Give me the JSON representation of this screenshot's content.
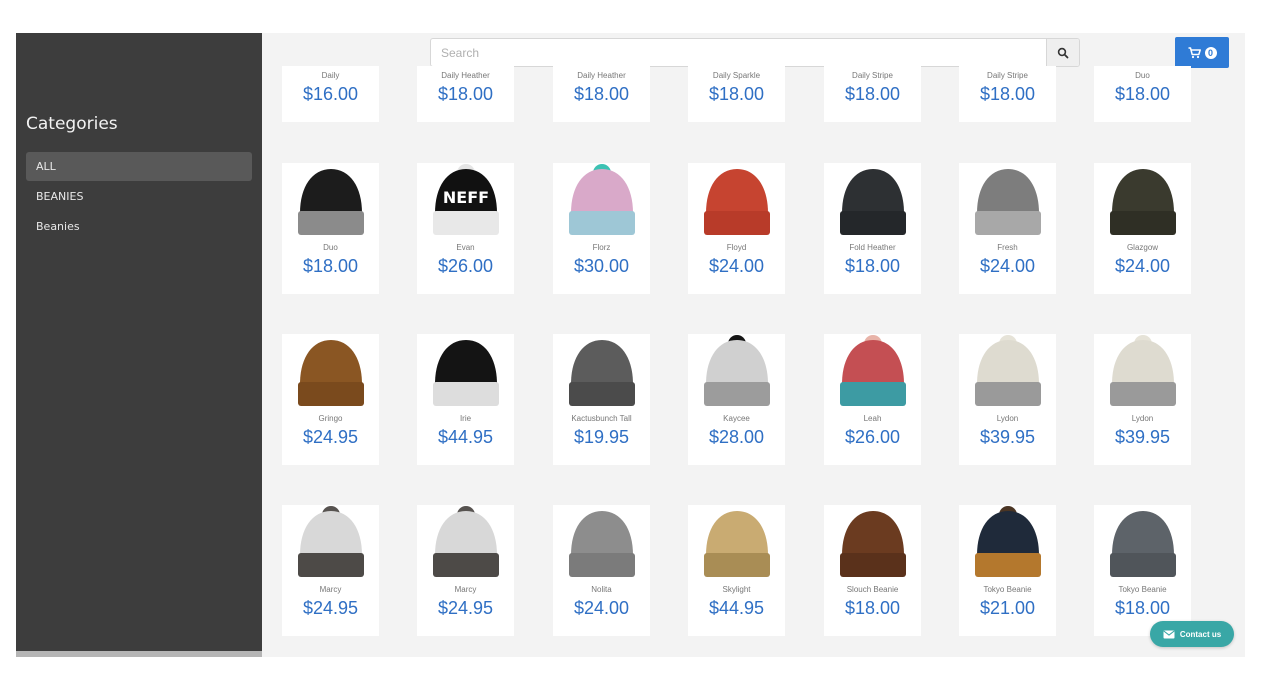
{
  "sidebar": {
    "title": "Categories",
    "items": [
      {
        "label": "ALL",
        "active": true
      },
      {
        "label": "BEANIES",
        "active": false
      },
      {
        "label": "Beanies",
        "active": false
      }
    ]
  },
  "header": {
    "search_placeholder": "Search",
    "search_icon": "search-icon",
    "cart_icon": "cart-icon",
    "cart_count": "0"
  },
  "contact": {
    "label": "Contact us",
    "icon": "mail-icon"
  },
  "products": [
    {
      "name": "Daily",
      "price": "$16.00"
    },
    {
      "name": "Daily Heather",
      "price": "$18.00"
    },
    {
      "name": "Daily Heather",
      "price": "$18.00"
    },
    {
      "name": "Daily Sparkle",
      "price": "$18.00"
    },
    {
      "name": "Daily Stripe",
      "price": "$18.00"
    },
    {
      "name": "Daily Stripe",
      "price": "$18.00"
    },
    {
      "name": "Duo",
      "price": "$18.00"
    },
    {
      "name": "Duo",
      "price": "$18.00",
      "colors": [
        "#1c1c1c",
        "#8b8b8b"
      ]
    },
    {
      "name": "Evan",
      "price": "$26.00",
      "colors": [
        "#111111",
        "#e8e8e8"
      ],
      "logo": "NEFF",
      "pom": "#e5e5e5"
    },
    {
      "name": "Florz",
      "price": "$30.00",
      "colors": [
        "#d9a9c9",
        "#9ec7d6"
      ],
      "pom": "#3cc2b3"
    },
    {
      "name": "Floyd",
      "price": "$24.00",
      "colors": [
        "#c64430",
        "#b83b29"
      ]
    },
    {
      "name": "Fold Heather",
      "price": "$18.00",
      "colors": [
        "#2d3033",
        "#24272a"
      ]
    },
    {
      "name": "Fresh",
      "price": "$24.00",
      "colors": [
        "#7d7d7d",
        "#a8a8a8"
      ]
    },
    {
      "name": "Glazgow",
      "price": "$24.00",
      "colors": [
        "#3a3a2e",
        "#2f2f25"
      ]
    },
    {
      "name": "Gringo",
      "price": "$24.95",
      "colors": [
        "#8a5623",
        "#7a4a1d"
      ]
    },
    {
      "name": "Irie",
      "price": "$44.95",
      "colors": [
        "#141414",
        "#dddddd"
      ]
    },
    {
      "name": "Kactusbunch Tall",
      "price": "$19.95",
      "colors": [
        "#5c5c5c",
        "#4b4b4b"
      ]
    },
    {
      "name": "Kaycee",
      "price": "$28.00",
      "colors": [
        "#d0d0d0",
        "#9c9c9c"
      ],
      "pom": "#151515"
    },
    {
      "name": "Leah",
      "price": "$26.00",
      "colors": [
        "#c44f53",
        "#3d9ba3"
      ],
      "pom": "#e8b3a8"
    },
    {
      "name": "Lydon",
      "price": "$39.95",
      "colors": [
        "#dedbd0",
        "#9a9a9a"
      ],
      "pom": "#e6e3d8"
    },
    {
      "name": "Lydon",
      "price": "$39.95",
      "colors": [
        "#dedbd0",
        "#9a9a9a"
      ],
      "pom": "#e6e3d8"
    },
    {
      "name": "Marcy",
      "price": "$24.95",
      "colors": [
        "#d8d8d8",
        "#4d4a47"
      ],
      "pom": "#575350"
    },
    {
      "name": "Marcy",
      "price": "$24.95",
      "colors": [
        "#d8d8d8",
        "#4d4a47"
      ],
      "pom": "#575350"
    },
    {
      "name": "Nolita",
      "price": "$24.00",
      "colors": [
        "#8d8d8d",
        "#7b7b7b"
      ]
    },
    {
      "name": "Skylight",
      "price": "$44.95",
      "colors": [
        "#c9ab72",
        "#a98d55"
      ]
    },
    {
      "name": "Slouch Beanie",
      "price": "$18.00",
      "colors": [
        "#6b3b20",
        "#5a311b"
      ]
    },
    {
      "name": "Tokyo Beanie",
      "price": "$21.00",
      "colors": [
        "#1f2a3a",
        "#b4782d"
      ],
      "pom": "#4a3524"
    },
    {
      "name": "Tokyo Beanie",
      "price": "$18.00",
      "colors": [
        "#5d6369",
        "#50555a"
      ]
    }
  ]
}
